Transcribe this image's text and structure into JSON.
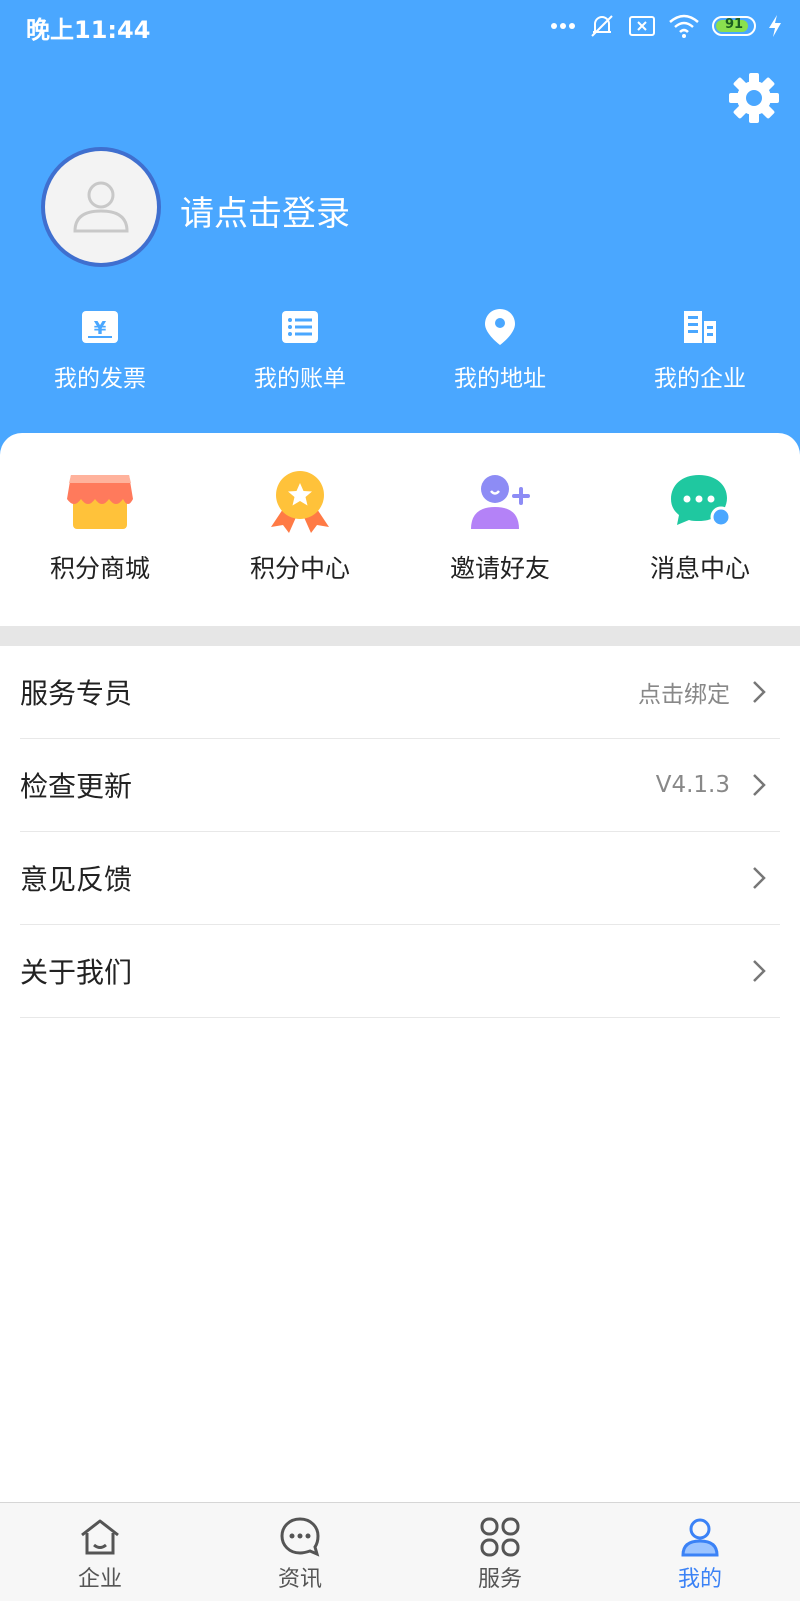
{
  "status_bar": {
    "time": "晚上11:44",
    "battery": "91",
    "battery_level": 0.91
  },
  "profile": {
    "login_prompt": "请点击登录"
  },
  "quick_actions": [
    {
      "label": "我的发票",
      "icon": "invoice-icon"
    },
    {
      "label": "我的账单",
      "icon": "bill-list-icon"
    },
    {
      "label": "我的地址",
      "icon": "location-pin-icon"
    },
    {
      "label": "我的企业",
      "icon": "building-icon"
    }
  ],
  "features": [
    {
      "label": "积分商城",
      "icon": "shop-icon"
    },
    {
      "label": "积分中心",
      "icon": "medal-icon"
    },
    {
      "label": "邀请好友",
      "icon": "add-friend-icon"
    },
    {
      "label": "消息中心",
      "icon": "message-icon"
    }
  ],
  "menu": [
    {
      "label": "服务专员",
      "value": "点击绑定"
    },
    {
      "label": "检查更新",
      "value": "V4.1.3"
    },
    {
      "label": "意见反馈",
      "value": ""
    },
    {
      "label": "关于我们",
      "value": ""
    }
  ],
  "tabs": [
    {
      "label": "企业",
      "icon": "home-icon"
    },
    {
      "label": "资讯",
      "icon": "chat-icon"
    },
    {
      "label": "服务",
      "icon": "grid-icon"
    },
    {
      "label": "我的",
      "icon": "user-icon",
      "active": true
    }
  ],
  "colors": {
    "header": "#4aa7ff",
    "active_tab": "#3b82f6"
  }
}
